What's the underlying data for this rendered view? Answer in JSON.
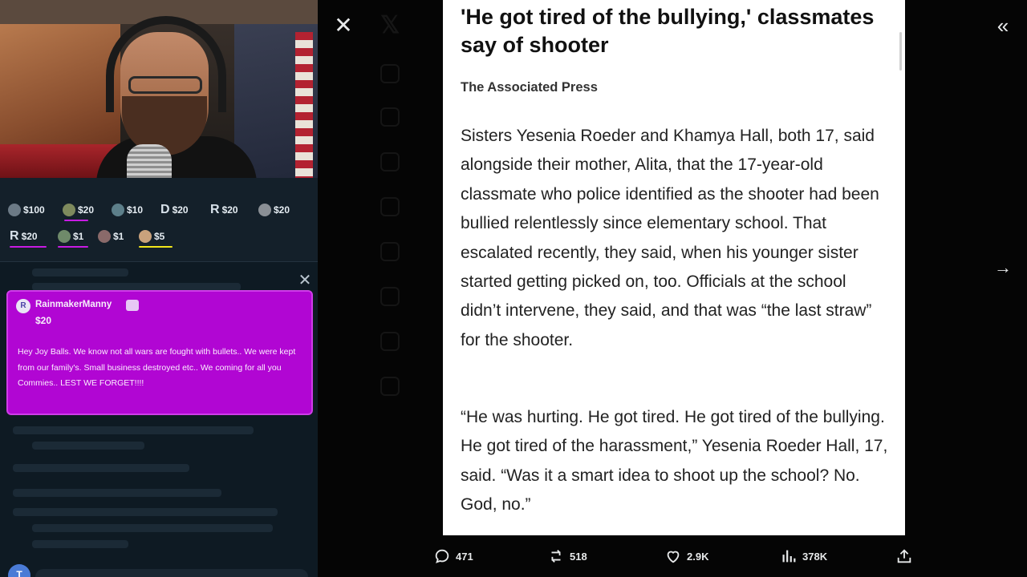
{
  "stream": {
    "tips": [
      {
        "avatar_letter": "",
        "amount": "$100"
      },
      {
        "avatar_letter": "",
        "amount": "$20"
      },
      {
        "avatar_letter": "",
        "amount": "$10"
      },
      {
        "avatar_letter": "D",
        "amount": "$20"
      },
      {
        "avatar_letter": "R",
        "amount": "$20"
      },
      {
        "avatar_letter": "",
        "amount": "$20"
      },
      {
        "avatar_letter": "R",
        "amount": "$20"
      },
      {
        "avatar_letter": "",
        "amount": "$1"
      },
      {
        "avatar_letter": "",
        "amount": "$1"
      },
      {
        "avatar_letter": "",
        "amount": "$5"
      }
    ],
    "alert": {
      "avatar_letter": "R",
      "username": "RainmakerManny",
      "amount": "$20",
      "message": "Hey Joy Balls. We know not all wars are fought with bullets.. We were kept from our family's. Small business destroyed etc.. We coming for all you Commies.. LEST WE FORGET!!!!"
    },
    "chat_input": {
      "avatar_letter": "T"
    },
    "colors": {
      "alert_bg": "#b106d3",
      "tip_bar": "#c81be3",
      "tip_bar_highlight": "#f2e61b"
    }
  },
  "viewer": {
    "article": {
      "headline": "'He got tired of the bullying,' classmates say of shooter",
      "byline": "The Associated Press",
      "paragraph_1": "Sisters Yesenia Roeder and Khamya Hall, both 17, said alongside their mother, Alita, that the 17-year-old classmate who police identified as the shooter had been bullied relentlessly since elementary school. That escalated recently, they said, when his younger sister started getting picked on, too. Officials at the school didn’t intervene, they said, and that was “the last straw” for the shooter.",
      "paragraph_2": "“He was hurting. He got tired. He got tired of the bullying. He got tired of the harassment,” Yesenia Roeder Hall, 17, said. “Was it a smart idea to shoot up the school? No. God, no.”"
    },
    "actions": {
      "replies": "471",
      "reposts": "518",
      "likes": "2.9K",
      "views": "378K"
    },
    "icons": {
      "close": "close-icon",
      "collapse": "double-chevron-left-icon",
      "next": "arrow-right-icon",
      "reply": "reply-icon",
      "repost": "repost-icon",
      "like": "heart-icon",
      "views": "views-icon",
      "share": "share-icon"
    }
  }
}
